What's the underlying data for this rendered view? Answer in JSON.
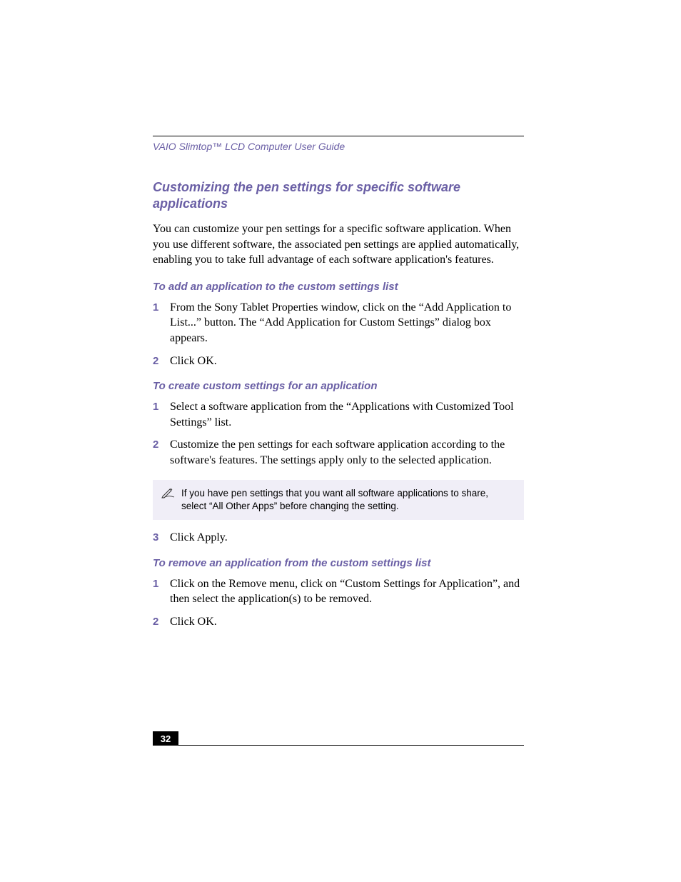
{
  "header": {
    "guide_title": "VAIO Slimtop™ LCD Computer User Guide"
  },
  "heading": "Customizing the pen settings for specific software applications",
  "intro": "You can customize your pen settings for a specific software application. When you use different software, the associated pen settings are applied automatically, enabling you to take full advantage of each software application's features.",
  "sections": {
    "add": {
      "title": "To add an application to the custom settings list",
      "steps": [
        "From the Sony Tablet Properties window, click on the “Add Application to List...” button. The “Add Application for Custom Settings” dialog box appears.",
        "Click OK."
      ]
    },
    "create": {
      "title": "To create custom settings for an application",
      "steps_a": [
        "Select a software application from the “Applications with Customized Tool Settings” list.",
        "Customize the pen settings for each software application according to the software's features. The settings apply only to the selected application."
      ],
      "note": "If you have pen settings that you want all software applications to share, select “All Other Apps” before changing the setting.",
      "steps_b": [
        "Click Apply."
      ]
    },
    "remove": {
      "title": "To remove an application from the custom settings list",
      "steps": [
        "Click on the Remove menu, click on “Custom Settings for Application”, and then select the application(s) to be removed.",
        "Click OK."
      ]
    }
  },
  "numbers": {
    "n1": "1",
    "n2": "2",
    "n3": "3"
  },
  "footer": {
    "page": "32"
  }
}
